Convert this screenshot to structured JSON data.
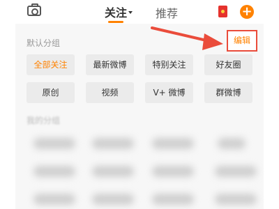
{
  "header": {
    "tabs": [
      {
        "label": "关注",
        "active": true
      },
      {
        "label": "推荐",
        "active": false
      }
    ],
    "icons": [
      "camera-icon",
      "red-packet-icon",
      "add-icon"
    ],
    "add_glyph": "+"
  },
  "default_group": {
    "title": "默认分组",
    "edit_label": "编辑",
    "chips": [
      {
        "label": "全部关注",
        "active": true
      },
      {
        "label": "最新微博",
        "active": false
      },
      {
        "label": "特别关注",
        "active": false
      },
      {
        "label": "好友圈",
        "active": false
      },
      {
        "label": "原创",
        "active": false
      },
      {
        "label": "视频",
        "active": false
      },
      {
        "label": "V+ 微博",
        "active": false
      },
      {
        "label": "群微博",
        "active": false
      }
    ]
  },
  "my_group": {
    "title": "我的分组"
  },
  "colors": {
    "accent": "#ff8200",
    "annotation": "#ea4c3b",
    "chip_bg": "#ebebeb",
    "panel_bg": "#f7f7f7"
  }
}
